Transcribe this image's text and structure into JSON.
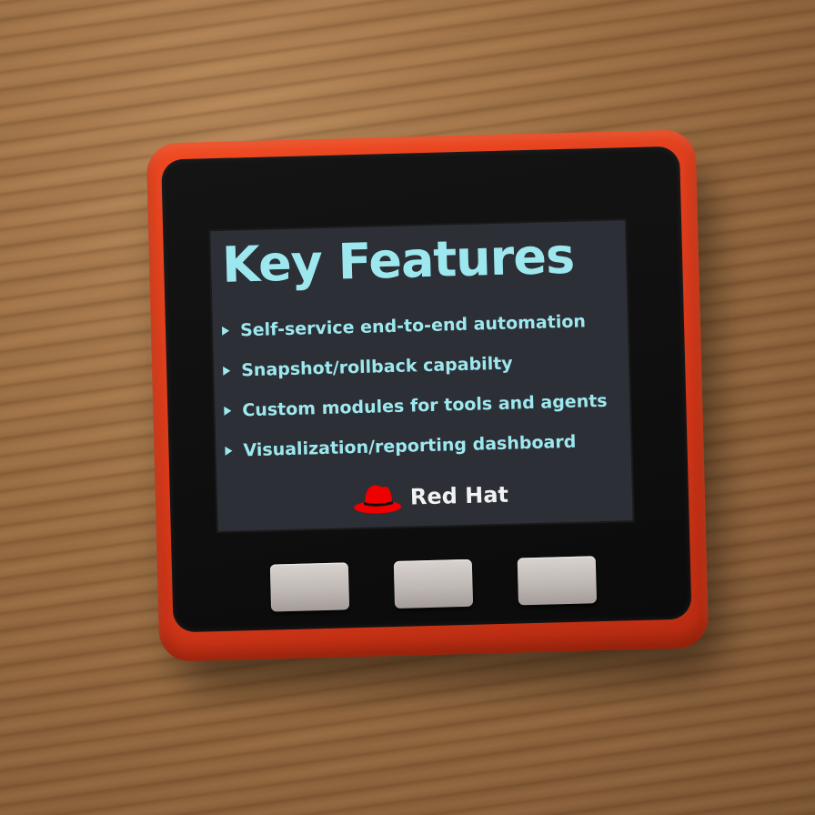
{
  "screen": {
    "title": "Key Features",
    "features": [
      "Self-service end-to-end automation",
      "Snapshot/rollback capabilty",
      "Custom modules for tools and agents",
      "Visualization/reporting dashboard"
    ],
    "brand": "Red Hat"
  },
  "icons": {
    "bullet": "triangle-bullet-icon",
    "logo": "red-hat-logo-icon"
  },
  "colors": {
    "screen_text": "#9de8ef",
    "screen_background": "#2c2f35",
    "device_case": "#e5401d",
    "brand_red": "#ee0000"
  }
}
